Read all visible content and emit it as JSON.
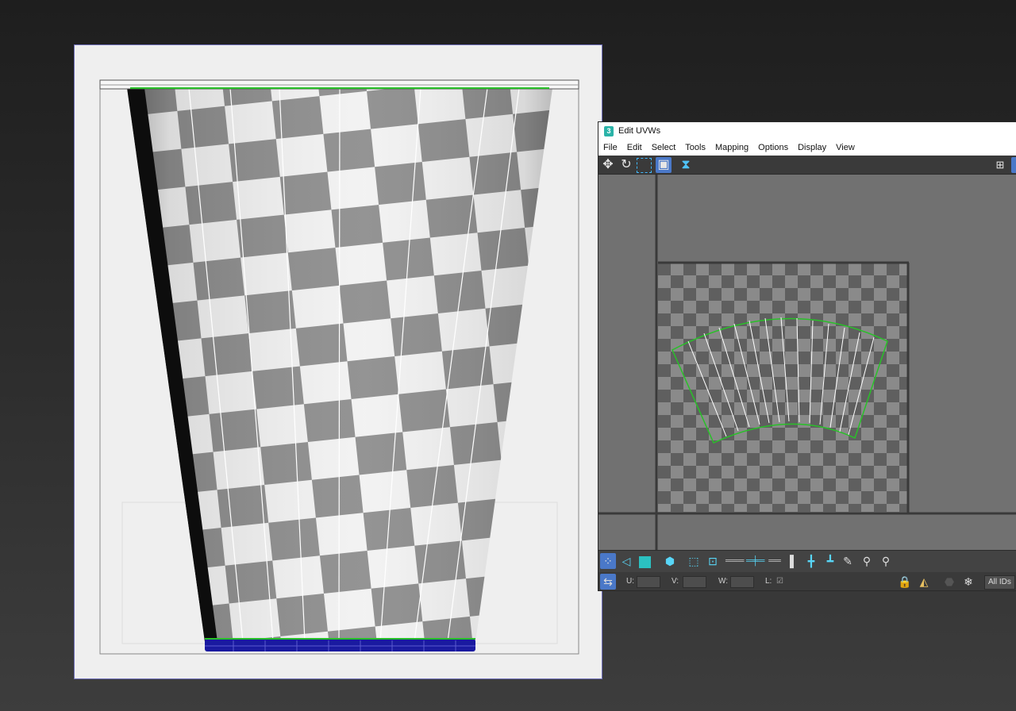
{
  "uvw_window": {
    "title": "Edit UVWs",
    "app_icon_glyph": "3",
    "menu": [
      "File",
      "Edit",
      "Select",
      "Tools",
      "Mapping",
      "Options",
      "Display",
      "View"
    ],
    "top_tools": [
      "move-icon",
      "rotate-icon",
      "freeform-icon",
      "scale-box-icon",
      "mirror-icon"
    ],
    "bottom_tools": [
      "sub-object-vertex-icon",
      "sub-object-edge-icon",
      "sub-object-face-icon",
      "element-icon",
      "select-mode-icon",
      "align-icons",
      "paint-select-icon",
      "brush-icons"
    ],
    "status": {
      "u_label": "U:",
      "v_label": "V:",
      "w_label": "W:",
      "l_label": "L:",
      "l_checked": true,
      "ids_dropdown": "All IDs"
    }
  },
  "colors": {
    "uv_shell_border": "#29c029",
    "uv_lines": "#ffffff",
    "selection_blue": "#1a1aa0",
    "active_tool": "#4a78c8"
  }
}
